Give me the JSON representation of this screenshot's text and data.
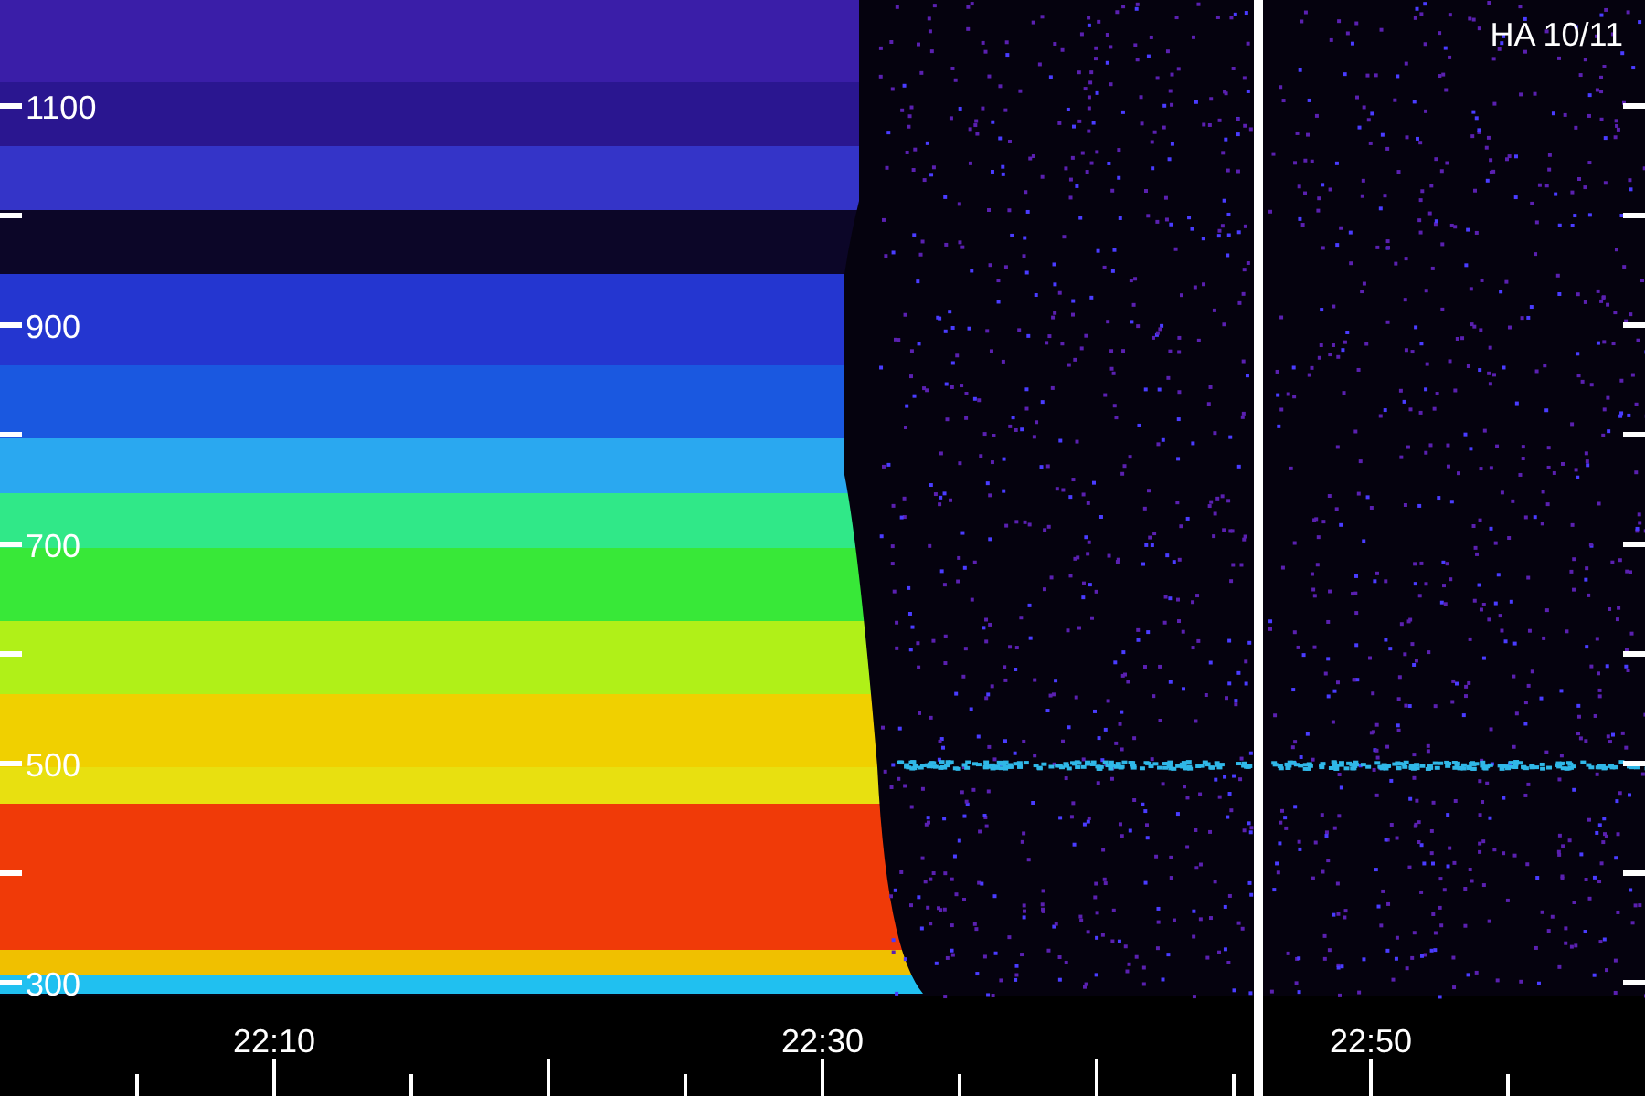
{
  "title": "HA 10/11",
  "y_axis": {
    "labels": [
      "1100",
      "900",
      "700",
      "500",
      "300"
    ]
  },
  "x_axis": {
    "labels": [
      "22:10",
      "22:30",
      "22:50"
    ]
  }
}
